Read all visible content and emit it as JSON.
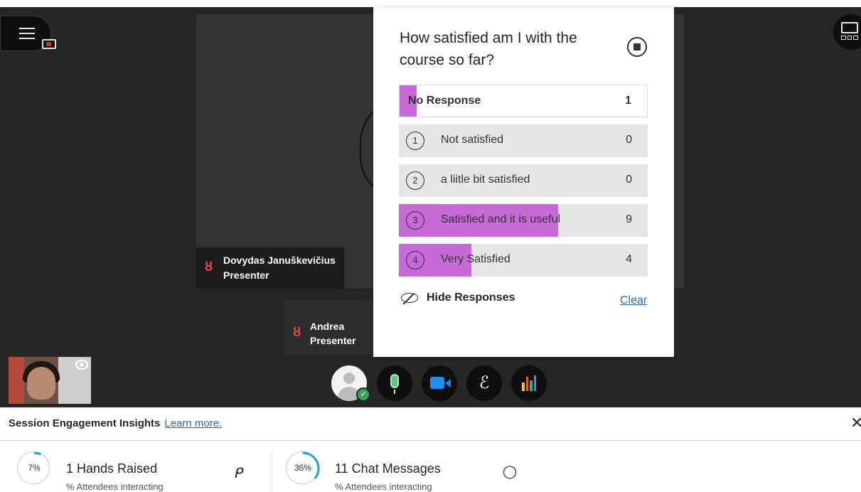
{
  "poll": {
    "question": "How satisfied am I with the course so far?",
    "responses": [
      {
        "label": "No Response",
        "count": "1",
        "fill_fraction": 0.07
      },
      {
        "number": "1",
        "label": "Not satisfied",
        "count": "0",
        "fill_fraction": 0
      },
      {
        "number": "2",
        "label": "a liitle bit satisfied",
        "count": "0",
        "fill_fraction": 0
      },
      {
        "number": "3",
        "label": "Satisfied and it is useful",
        "count": "9",
        "fill_fraction": 0.64
      },
      {
        "number": "4",
        "label": "Very Satisfied",
        "count": "4",
        "fill_fraction": 0.29
      }
    ],
    "hide_label": "Hide Responses",
    "clear_label": "Clear",
    "fill_color": "#c76ad8"
  },
  "participants": [
    {
      "name": "Dovydas Januškevičius",
      "role": "Presenter"
    },
    {
      "name": "Andrea",
      "role": "Presenter"
    }
  ],
  "icons": {
    "mic_off": "mic-off-icon",
    "menu": "hamburger-menu-icon",
    "recording": "recording-camera-icon",
    "layout": "layout-grid-icon",
    "microphone": "microphone-icon",
    "camera": "camera-icon",
    "hand": "raise-hand-icon",
    "activity": "activity-bars-icon",
    "chat": "chat-bubble-icon",
    "eye": "eye-icon"
  },
  "insights": {
    "title": "Session Engagement Insights",
    "learn_more": "Learn more.",
    "close_glyph": "✕",
    "metrics": [
      {
        "percent_label": "7%",
        "percent": 7,
        "heading": "1 Hands Raised",
        "sub": "% Attendees interacting",
        "icon_glyph": "ᑭ"
      },
      {
        "percent_label": "36%",
        "percent": 36,
        "heading": "11 Chat Messages",
        "sub": "% Attendees interacting",
        "icon_glyph": "◯"
      }
    ],
    "gauge_color": "#1fa3d6"
  },
  "colors": {
    "stage_bg": "#262626",
    "link": "#2b6aa8",
    "mic_off": "#e5494a"
  }
}
